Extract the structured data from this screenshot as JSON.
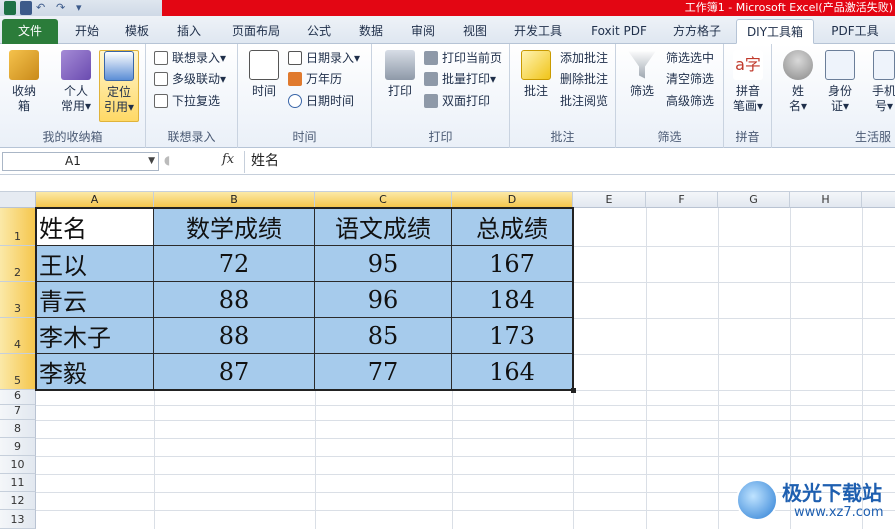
{
  "window": {
    "title": "工作簿1 - Microsoft Excel(产品激活失败)"
  },
  "colors": {
    "file_tab": "#2b7c3a",
    "title_bar_red": "#e30613",
    "selected_cell_fill": "#a6cbec",
    "highlight_header": "#f5c64d"
  },
  "tabs": [
    {
      "label": "文件",
      "active": false,
      "file": true
    },
    {
      "label": "开始",
      "active": false
    },
    {
      "label": "模板",
      "active": false
    },
    {
      "label": "插入",
      "active": false
    },
    {
      "label": "页面布局",
      "active": false
    },
    {
      "label": "公式",
      "active": false
    },
    {
      "label": "数据",
      "active": false
    },
    {
      "label": "审阅",
      "active": false
    },
    {
      "label": "视图",
      "active": false
    },
    {
      "label": "开发工具",
      "active": false
    },
    {
      "label": "Foxit PDF",
      "active": false
    },
    {
      "label": "方方格子",
      "active": false
    },
    {
      "label": "DIY工具箱",
      "active": true
    },
    {
      "label": "PDF工具",
      "active": false
    }
  ],
  "ribbon": {
    "groups": {
      "storage": {
        "title": "我的收纳箱",
        "buttons": [
          "收纳\n箱",
          "个人\n常用▾",
          "定位\n引用▾"
        ]
      },
      "association": {
        "title": "联想录入",
        "buttons": [
          "联想录入▾",
          "多级联动▾",
          "下拉复选"
        ]
      },
      "time": {
        "title": "时间",
        "big": "时间",
        "buttons": [
          "日期录入▾",
          "万年历",
          "日期时间"
        ]
      },
      "print": {
        "title": "打印",
        "big": "打印",
        "buttons": [
          "打印当前页",
          "批量打印▾",
          "双面打印"
        ]
      },
      "comment": {
        "title": "批注",
        "big": "批注",
        "buttons": [
          "添加批注",
          "删除批注",
          "批注阅览"
        ]
      },
      "filter": {
        "title": "筛选",
        "big": "筛选",
        "buttons": [
          "筛选选中",
          "清空筛选",
          "高级筛选"
        ]
      },
      "pinyin": {
        "title": "拼音",
        "big": "拼音\n笔画▾"
      },
      "life": {
        "title": "生活服",
        "buttons": [
          "姓\n名▾",
          "身份\n证▾",
          "手机\n号▾"
        ]
      }
    }
  },
  "formula_bar": {
    "name_box": "A1",
    "fx_label": "fx",
    "content": "姓名"
  },
  "sheet": {
    "columns": [
      "A",
      "B",
      "C",
      "D",
      "E",
      "F",
      "G",
      "H"
    ],
    "rows": [
      "1",
      "2",
      "3",
      "4",
      "5",
      "6",
      "7",
      "8",
      "9",
      "10",
      "11",
      "12",
      "13"
    ],
    "table": {
      "headers": [
        "姓名",
        "数学成绩",
        "语文成绩",
        "总成绩"
      ],
      "rows": [
        [
          "王以",
          "72",
          "95",
          "167"
        ],
        [
          "青云",
          "88",
          "96",
          "184"
        ],
        [
          "李木子",
          "88",
          "85",
          "173"
        ],
        [
          "李毅",
          "87",
          "77",
          "164"
        ]
      ]
    }
  },
  "watermark": {
    "brand": "极光下载站",
    "url": "www.xz7.com"
  }
}
